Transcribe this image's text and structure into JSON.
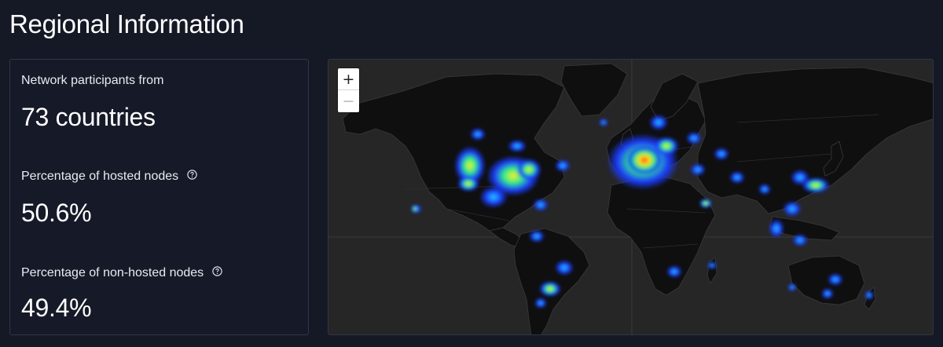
{
  "page": {
    "title": "Regional Information"
  },
  "stats": {
    "participants_label": "Network participants from",
    "participants_value": "73 countries",
    "hosted_label": "Percentage of hosted nodes",
    "hosted_value": "50.6%",
    "nonhosted_label": "Percentage of non-hosted nodes",
    "nonhosted_value": "49.4%"
  },
  "map": {
    "zoom_in_label": "+",
    "zoom_out_label": "−",
    "colors": {
      "water": "#262626",
      "land": "#101010",
      "borders": "#3a3a3a",
      "heat_low": "#1b2cff",
      "heat_mid": "#16e08a",
      "heat_high": "#f2e21a",
      "heat_peak": "#ff4a1a"
    }
  }
}
